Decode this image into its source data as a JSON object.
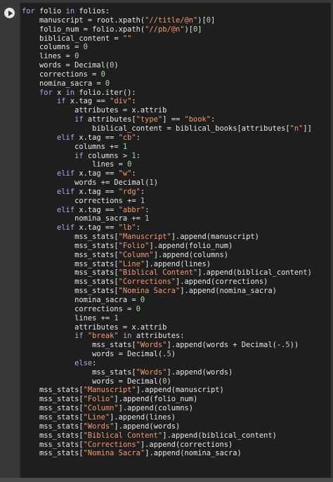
{
  "colors": {
    "background": "#383838",
    "editor_background": "#1e1e1e",
    "keyword": "#b9a3f0",
    "string": "#f59a6b",
    "number": "#a9dca6",
    "text": "#e8e8e8"
  },
  "run_button": {
    "icon": "play-icon"
  },
  "code": {
    "lines": [
      [
        [
          "kw",
          "for"
        ],
        [
          "t",
          " folio "
        ],
        [
          "kw",
          "in"
        ],
        [
          "t",
          " folios:"
        ]
      ],
      [
        [
          "t",
          "    manuscript = root.xpath("
        ],
        [
          "s",
          "\"//title/@n\""
        ],
        [
          "t",
          ")["
        ],
        [
          "n",
          "0"
        ],
        [
          "t",
          "]"
        ]
      ],
      [
        [
          "t",
          "    folio_num = folio.xpath("
        ],
        [
          "s",
          "\"//pb/@n\""
        ],
        [
          "t",
          ")["
        ],
        [
          "n",
          "0"
        ],
        [
          "t",
          "]"
        ]
      ],
      [
        [
          "t",
          "    biblical_content = "
        ],
        [
          "s",
          "\"\""
        ]
      ],
      [
        [
          "t",
          "    columns = "
        ],
        [
          "n",
          "0"
        ]
      ],
      [
        [
          "t",
          "    lines = "
        ],
        [
          "n",
          "0"
        ]
      ],
      [
        [
          "t",
          "    words = Decimal("
        ],
        [
          "n",
          "0"
        ],
        [
          "t",
          ")"
        ]
      ],
      [
        [
          "t",
          "    corrections = "
        ],
        [
          "n",
          "0"
        ]
      ],
      [
        [
          "t",
          "    nomina_sacra = "
        ],
        [
          "n",
          "0"
        ]
      ],
      [
        [
          "t",
          "    "
        ],
        [
          "kw",
          "for"
        ],
        [
          "t",
          " x "
        ],
        [
          "kw",
          "in"
        ],
        [
          "t",
          " folio.iter():"
        ]
      ],
      [
        [
          "t",
          "        "
        ],
        [
          "kw",
          "if"
        ],
        [
          "t",
          " x.tag == "
        ],
        [
          "s",
          "\"div\""
        ],
        [
          "t",
          ":"
        ]
      ],
      [
        [
          "t",
          "            attributes = x.attrib"
        ]
      ],
      [
        [
          "t",
          "            "
        ],
        [
          "kw",
          "if"
        ],
        [
          "t",
          " attributes["
        ],
        [
          "s",
          "\"type\""
        ],
        [
          "t",
          "] == "
        ],
        [
          "s",
          "\"book\""
        ],
        [
          "t",
          ":"
        ]
      ],
      [
        [
          "t",
          "                biblical_content = biblical_books[attributes["
        ],
        [
          "s",
          "\"n\""
        ],
        [
          "t",
          "]]"
        ]
      ],
      [
        [
          "t",
          "        "
        ],
        [
          "kw",
          "elif"
        ],
        [
          "t",
          " x.tag == "
        ],
        [
          "s",
          "\"cb\""
        ],
        [
          "t",
          ":"
        ]
      ],
      [
        [
          "t",
          "            columns += "
        ],
        [
          "n",
          "1"
        ]
      ],
      [
        [
          "t",
          "            "
        ],
        [
          "kw",
          "if"
        ],
        [
          "t",
          " columns > "
        ],
        [
          "n",
          "1"
        ],
        [
          "t",
          ":"
        ]
      ],
      [
        [
          "t",
          "                lines = "
        ],
        [
          "n",
          "0"
        ]
      ],
      [
        [
          "t",
          "        "
        ],
        [
          "kw",
          "elif"
        ],
        [
          "t",
          " x.tag == "
        ],
        [
          "s",
          "\"w\""
        ],
        [
          "t",
          ":"
        ]
      ],
      [
        [
          "t",
          "            words += Decimal("
        ],
        [
          "n",
          "1"
        ],
        [
          "t",
          ")"
        ]
      ],
      [
        [
          "t",
          "        "
        ],
        [
          "kw",
          "elif"
        ],
        [
          "t",
          " x.tag == "
        ],
        [
          "s",
          "\"rdg\""
        ],
        [
          "t",
          ":"
        ]
      ],
      [
        [
          "t",
          "            corrections += "
        ],
        [
          "n",
          "1"
        ]
      ],
      [
        [
          "t",
          "        "
        ],
        [
          "kw",
          "elif"
        ],
        [
          "t",
          " x.tag == "
        ],
        [
          "s",
          "\"abbr\""
        ],
        [
          "t",
          ":"
        ]
      ],
      [
        [
          "t",
          "            nomina_sacra += "
        ],
        [
          "n",
          "1"
        ]
      ],
      [
        [
          "t",
          "        "
        ],
        [
          "kw",
          "elif"
        ],
        [
          "t",
          " x.tag == "
        ],
        [
          "s",
          "\"lb\""
        ],
        [
          "t",
          ":"
        ]
      ],
      [
        [
          "t",
          "            mss_stats["
        ],
        [
          "s",
          "\"Manuscript\""
        ],
        [
          "t",
          "].append(manuscript)"
        ]
      ],
      [
        [
          "t",
          "            mss_stats["
        ],
        [
          "s",
          "\"Folio\""
        ],
        [
          "t",
          "].append(folio_num)"
        ]
      ],
      [
        [
          "t",
          "            mss_stats["
        ],
        [
          "s",
          "\"Column\""
        ],
        [
          "t",
          "].append(columns)"
        ]
      ],
      [
        [
          "t",
          "            mss_stats["
        ],
        [
          "s",
          "\"Line\""
        ],
        [
          "t",
          "].append(lines)"
        ]
      ],
      [
        [
          "t",
          "            mss_stats["
        ],
        [
          "s",
          "\"Biblical Content\""
        ],
        [
          "t",
          "].append(biblical_content)"
        ]
      ],
      [
        [
          "t",
          "            mss_stats["
        ],
        [
          "s",
          "\"Corrections\""
        ],
        [
          "t",
          "].append(corrections)"
        ]
      ],
      [
        [
          "t",
          "            mss_stats["
        ],
        [
          "s",
          "\"Nomina Sacra\""
        ],
        [
          "t",
          "].append(nomina_sacra)"
        ]
      ],
      [
        [
          "t",
          "            nomina_sacra = "
        ],
        [
          "n",
          "0"
        ]
      ],
      [
        [
          "t",
          "            corrections = "
        ],
        [
          "n",
          "0"
        ]
      ],
      [
        [
          "t",
          "            lines += "
        ],
        [
          "n",
          "1"
        ]
      ],
      [
        [
          "t",
          "            attributes = x.attrib"
        ]
      ],
      [
        [
          "t",
          "            "
        ],
        [
          "kw",
          "if"
        ],
        [
          "t",
          " "
        ],
        [
          "s",
          "\"break\""
        ],
        [
          "t",
          " "
        ],
        [
          "kw",
          "in"
        ],
        [
          "t",
          " attributes:"
        ]
      ],
      [
        [
          "t",
          "                mss_stats["
        ],
        [
          "s",
          "\"Words\""
        ],
        [
          "t",
          "].append(words + Decimal(-."
        ],
        [
          "n",
          "5"
        ],
        [
          "t",
          "))"
        ]
      ],
      [
        [
          "t",
          "                words = Decimal(."
        ],
        [
          "n",
          "5"
        ],
        [
          "t",
          ")"
        ]
      ],
      [
        [
          "t",
          "            "
        ],
        [
          "kw",
          "else"
        ],
        [
          "t",
          ":"
        ]
      ],
      [
        [
          "t",
          "                mss_stats["
        ],
        [
          "s",
          "\"Words\""
        ],
        [
          "t",
          "].append(words)"
        ]
      ],
      [
        [
          "t",
          "                words = Decimal("
        ],
        [
          "n",
          "0"
        ],
        [
          "t",
          ")"
        ]
      ],
      [
        [
          "t",
          "    mss_stats["
        ],
        [
          "s",
          "\"Manuscript\""
        ],
        [
          "t",
          "].append(manuscript)"
        ]
      ],
      [
        [
          "t",
          "    mss_stats["
        ],
        [
          "s",
          "\"Folio\""
        ],
        [
          "t",
          "].append(folio_num)"
        ]
      ],
      [
        [
          "t",
          "    mss_stats["
        ],
        [
          "s",
          "\"Column\""
        ],
        [
          "t",
          "].append(columns)"
        ]
      ],
      [
        [
          "t",
          "    mss_stats["
        ],
        [
          "s",
          "\"Line\""
        ],
        [
          "t",
          "].append(lines)"
        ]
      ],
      [
        [
          "t",
          "    mss_stats["
        ],
        [
          "s",
          "\"Words\""
        ],
        [
          "t",
          "].append(words)"
        ]
      ],
      [
        [
          "t",
          "    mss_stats["
        ],
        [
          "s",
          "\"Biblical Content\""
        ],
        [
          "t",
          "].append(biblical_content)"
        ]
      ],
      [
        [
          "t",
          "    mss_stats["
        ],
        [
          "s",
          "\"Corrections\""
        ],
        [
          "t",
          "].append(corrections)"
        ]
      ],
      [
        [
          "t",
          "    mss_stats["
        ],
        [
          "s",
          "\"Nomina Sacra\""
        ],
        [
          "t",
          "].append(nomina_sacra)"
        ]
      ]
    ]
  }
}
